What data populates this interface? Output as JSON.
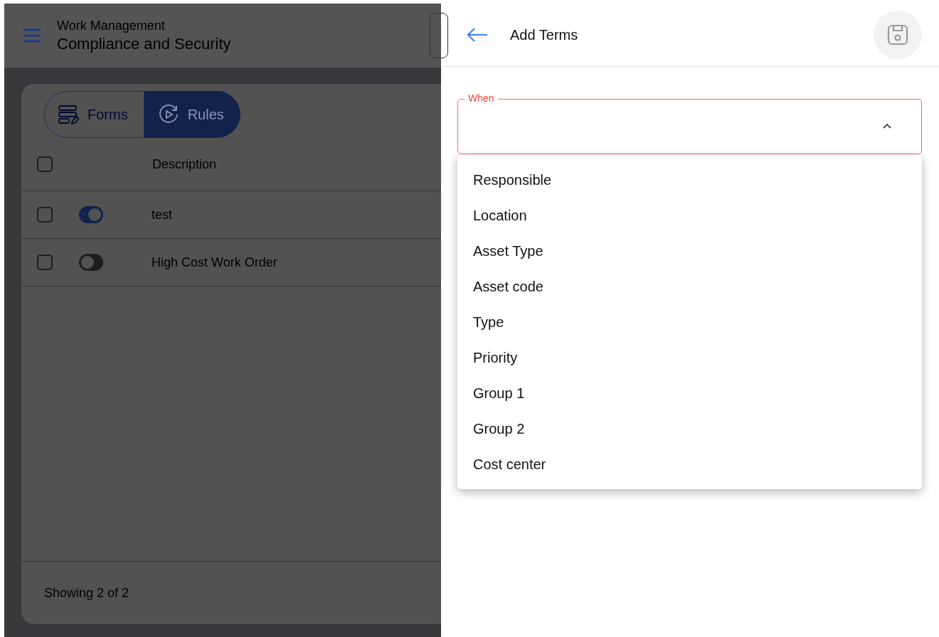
{
  "header": {
    "subtitle": "Work Management",
    "title": "Compliance and Security"
  },
  "tabs": [
    {
      "label": "Forms",
      "kind": "forms",
      "selected": false
    },
    {
      "label": "Rules",
      "kind": "rules",
      "selected": true
    }
  ],
  "table": {
    "columns": [
      "Description"
    ],
    "header_checked": false,
    "rows": [
      {
        "checked": false,
        "on": true,
        "description": "test"
      },
      {
        "checked": false,
        "on": false,
        "description": "High Cost Work Order"
      }
    ]
  },
  "footer": "Showing 2 of 2",
  "panel": {
    "title": "Add Terms",
    "field": {
      "label": "When",
      "expanded": true
    },
    "options": [
      "Responsible",
      "Location",
      "Asset Type",
      "Asset code",
      "Type",
      "Priority",
      "Group 1",
      "Group 2",
      "Cost center"
    ]
  }
}
